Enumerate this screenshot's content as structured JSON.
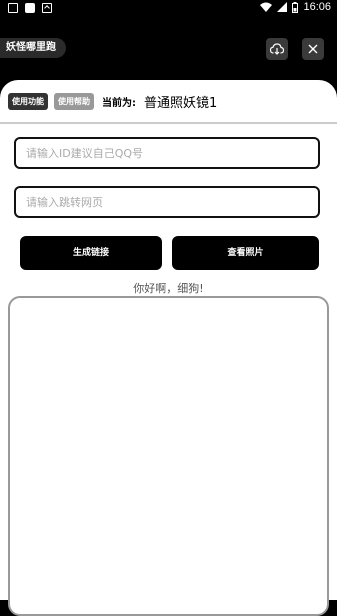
{
  "status_bar": {
    "time": "16:06",
    "icons": [
      "image-icon",
      "square-icon",
      "a-icon",
      "wifi-icon",
      "signal-icon",
      "battery-icon"
    ]
  },
  "header": {
    "title": "妖怪哪里跑",
    "cloud_icon": "cloud-download-icon",
    "close_icon": "close-icon"
  },
  "tabs": [
    {
      "label": "使用功能",
      "active": true
    },
    {
      "label": "使用帮助",
      "active": false
    }
  ],
  "current": {
    "label": "当前为:",
    "value": "普通照妖镜1"
  },
  "inputs": {
    "id_placeholder": "请输入ID建议自己QQ号",
    "url_placeholder": "请输入跳转网页"
  },
  "buttons": {
    "generate": "生成链接",
    "view_photos": "查看照片"
  },
  "greeting": "你好啊，细狗!",
  "colors": {
    "background": "#000000",
    "card": "#ffffff",
    "active_tab": "#333333",
    "inactive_tab": "#999999"
  }
}
